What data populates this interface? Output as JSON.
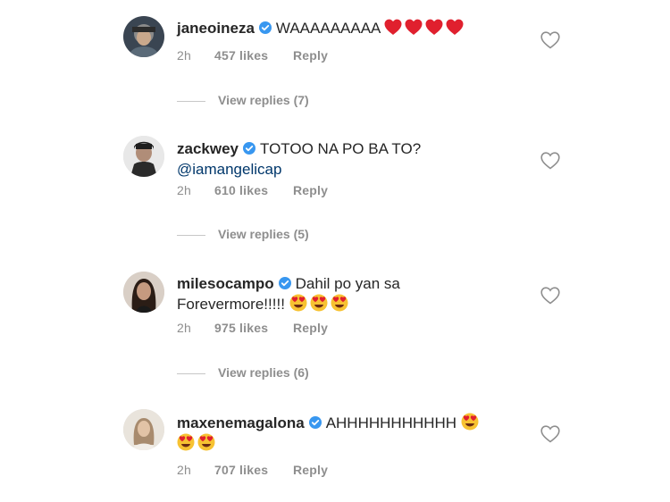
{
  "comments": [
    {
      "username": "janeoineza",
      "text": "WAAAAAAAAA",
      "mention": "",
      "time": "2h",
      "likes": "457 likes",
      "reply": "Reply",
      "emoji": [
        "red-heart",
        "red-heart",
        "red-heart",
        "red-heart"
      ],
      "emoji_line2": []
    },
    {
      "username": "zackwey",
      "text": "TOTOO NA PO BA TO?",
      "mention": "@iamangelicap",
      "time": "2h",
      "likes": "610 likes",
      "reply": "Reply",
      "emoji": [],
      "emoji_line2": []
    },
    {
      "username": "milesocampo",
      "text": "Dahil po yan sa",
      "text_line2": "Forevermore!!!!!",
      "time": "2h",
      "likes": "975 likes",
      "reply": "Reply",
      "emoji": [
        "heart-eyes",
        "heart-eyes",
        "heart-eyes"
      ],
      "emoji_line2": []
    },
    {
      "username": "maxenemagalona",
      "text": "AHHHHHHHHHHH",
      "time": "2h",
      "likes": "707 likes",
      "reply": "Reply",
      "emoji": [
        "heart-eyes"
      ],
      "emoji_line2": [
        "heart-eyes",
        "heart-eyes"
      ]
    }
  ],
  "view_replies": [
    "View replies (7)",
    "View replies (5)",
    "View replies (6)"
  ],
  "colors": {
    "username": "#262626",
    "meta": "#8e8e8e",
    "mention": "#00376b",
    "verified": "#3897f0"
  }
}
